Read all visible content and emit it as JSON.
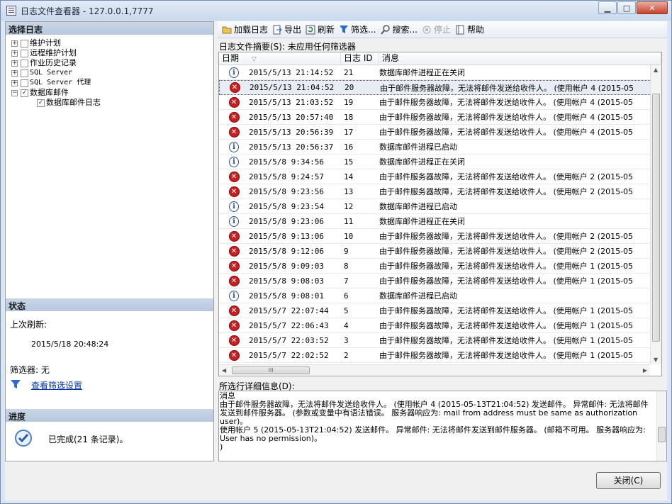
{
  "window": {
    "title": "日志文件查看器 - 127.0.0.1,7777",
    "minimize": "▁",
    "maximize": "□",
    "close": "✕"
  },
  "left": {
    "select_header": "选择日志",
    "tree": [
      {
        "label": "维护计划",
        "checked": false,
        "expanded": false
      },
      {
        "label": "远程维护计划",
        "checked": false,
        "expanded": false
      },
      {
        "label": "作业历史记录",
        "checked": false,
        "expanded": false
      },
      {
        "label": "SQL Server",
        "checked": false,
        "expanded": false
      },
      {
        "label": "SQL Server 代理",
        "checked": false,
        "expanded": false
      },
      {
        "label": "数据库邮件",
        "checked": true,
        "expanded": true
      },
      {
        "label": "数据库邮件日志",
        "checked": true,
        "expanded": null
      }
    ],
    "status_header": "状态",
    "last_refresh_label": "上次刷新:",
    "last_refresh_value": "2015/5/18 20:48:24",
    "filter_label": "筛选器: 无",
    "filter_link": "查看筛选设置",
    "progress_header": "进度",
    "progress_text": "已完成(21 条记录)。"
  },
  "toolbar": {
    "load": "加载日志",
    "export": "导出",
    "refresh": "刷新",
    "filter": "筛选...",
    "search": "搜索...",
    "stop": "停止",
    "help": "帮助"
  },
  "summary": "日志文件摘要(S): 未应用任何筛选器",
  "grid": {
    "headers": {
      "date": "日期",
      "id": "日志 ID",
      "message": "消息"
    },
    "rows": [
      {
        "type": "info",
        "date": "2015/5/13 21:14:52",
        "id": "21",
        "msg": "数据库邮件进程正在关闭"
      },
      {
        "type": "error",
        "date": "2015/5/13 21:04:52",
        "id": "20",
        "msg": "由于邮件服务器故障，无法将邮件发送给收件人。 (使用帐户 4 (2015-05"
      },
      {
        "type": "error",
        "date": "2015/5/13 21:03:52",
        "id": "19",
        "msg": "由于邮件服务器故障，无法将邮件发送给收件人。 (使用帐户 4 (2015-05"
      },
      {
        "type": "error",
        "date": "2015/5/13 20:57:40",
        "id": "18",
        "msg": "由于邮件服务器故障，无法将邮件发送给收件人。 (使用帐户 4 (2015-05"
      },
      {
        "type": "error",
        "date": "2015/5/13 20:56:39",
        "id": "17",
        "msg": "由于邮件服务器故障，无法将邮件发送给收件人。 (使用帐户 4 (2015-05"
      },
      {
        "type": "info",
        "date": "2015/5/13 20:56:37",
        "id": "16",
        "msg": "数据库邮件进程已启动"
      },
      {
        "type": "info",
        "date": "2015/5/8 9:34:56",
        "id": "15",
        "msg": "数据库邮件进程正在关闭"
      },
      {
        "type": "error",
        "date": "2015/5/8 9:24:57",
        "id": "14",
        "msg": "由于邮件服务器故障，无法将邮件发送给收件人。 (使用帐户 2 (2015-05"
      },
      {
        "type": "error",
        "date": "2015/5/8 9:23:56",
        "id": "13",
        "msg": "由于邮件服务器故障，无法将邮件发送给收件人。 (使用帐户 2 (2015-05"
      },
      {
        "type": "info",
        "date": "2015/5/8 9:23:54",
        "id": "12",
        "msg": "数据库邮件进程已启动"
      },
      {
        "type": "info",
        "date": "2015/5/8 9:23:06",
        "id": "11",
        "msg": "数据库邮件进程正在关闭"
      },
      {
        "type": "error",
        "date": "2015/5/8 9:13:06",
        "id": "10",
        "msg": "由于邮件服务器故障，无法将邮件发送给收件人。 (使用帐户 2 (2015-05"
      },
      {
        "type": "error",
        "date": "2015/5/8 9:12:06",
        "id": "9",
        "msg": "由于邮件服务器故障，无法将邮件发送给收件人。 (使用帐户 2 (2015-05"
      },
      {
        "type": "error",
        "date": "2015/5/8 9:09:03",
        "id": "8",
        "msg": "由于邮件服务器故障，无法将邮件发送给收件人。 (使用帐户 1 (2015-05"
      },
      {
        "type": "error",
        "date": "2015/5/8 9:08:03",
        "id": "7",
        "msg": "由于邮件服务器故障，无法将邮件发送给收件人。 (使用帐户 1 (2015-05"
      },
      {
        "type": "info",
        "date": "2015/5/8 9:08:01",
        "id": "6",
        "msg": "数据库邮件进程已启动"
      },
      {
        "type": "error",
        "date": "2015/5/7 22:07:44",
        "id": "5",
        "msg": "由于邮件服务器故障，无法将邮件发送给收件人。 (使用帐户 1 (2015-05"
      },
      {
        "type": "error",
        "date": "2015/5/7 22:06:43",
        "id": "4",
        "msg": "由于邮件服务器故障，无法将邮件发送给收件人。 (使用帐户 1 (2015-05"
      },
      {
        "type": "error",
        "date": "2015/5/7 22:03:52",
        "id": "3",
        "msg": "由于邮件服务器故障，无法将邮件发送给收件人。 (使用帐户 1 (2015-05"
      },
      {
        "type": "error",
        "date": "2015/5/7 22:02:52",
        "id": "2",
        "msg": "由于邮件服务器故障，无法将邮件发送给收件人。 (使用帐户 1 (2015-05"
      }
    ],
    "selected_index": 1,
    "hscroll_thumb": "III"
  },
  "detail": {
    "label": "所选行详细信息(D):",
    "text": "消息\n由于邮件服务器故障，无法将邮件发送给收件人。 (使用帐户 4 (2015-05-13T21:04:52) 发送邮件。 异常邮件: 无法将邮件发送到邮件服务器。 (参数或变量中有语法错误。 服务器响应为: mail from address must be same as authorization user)。\n使用帐户 5 (2015-05-13T21:04:52) 发送邮件。 异常邮件: 无法将邮件发送到邮件服务器。 (邮箱不可用。 服务器响应为: User has no permission)。\n)"
  },
  "close_button": "关闭(C)"
}
